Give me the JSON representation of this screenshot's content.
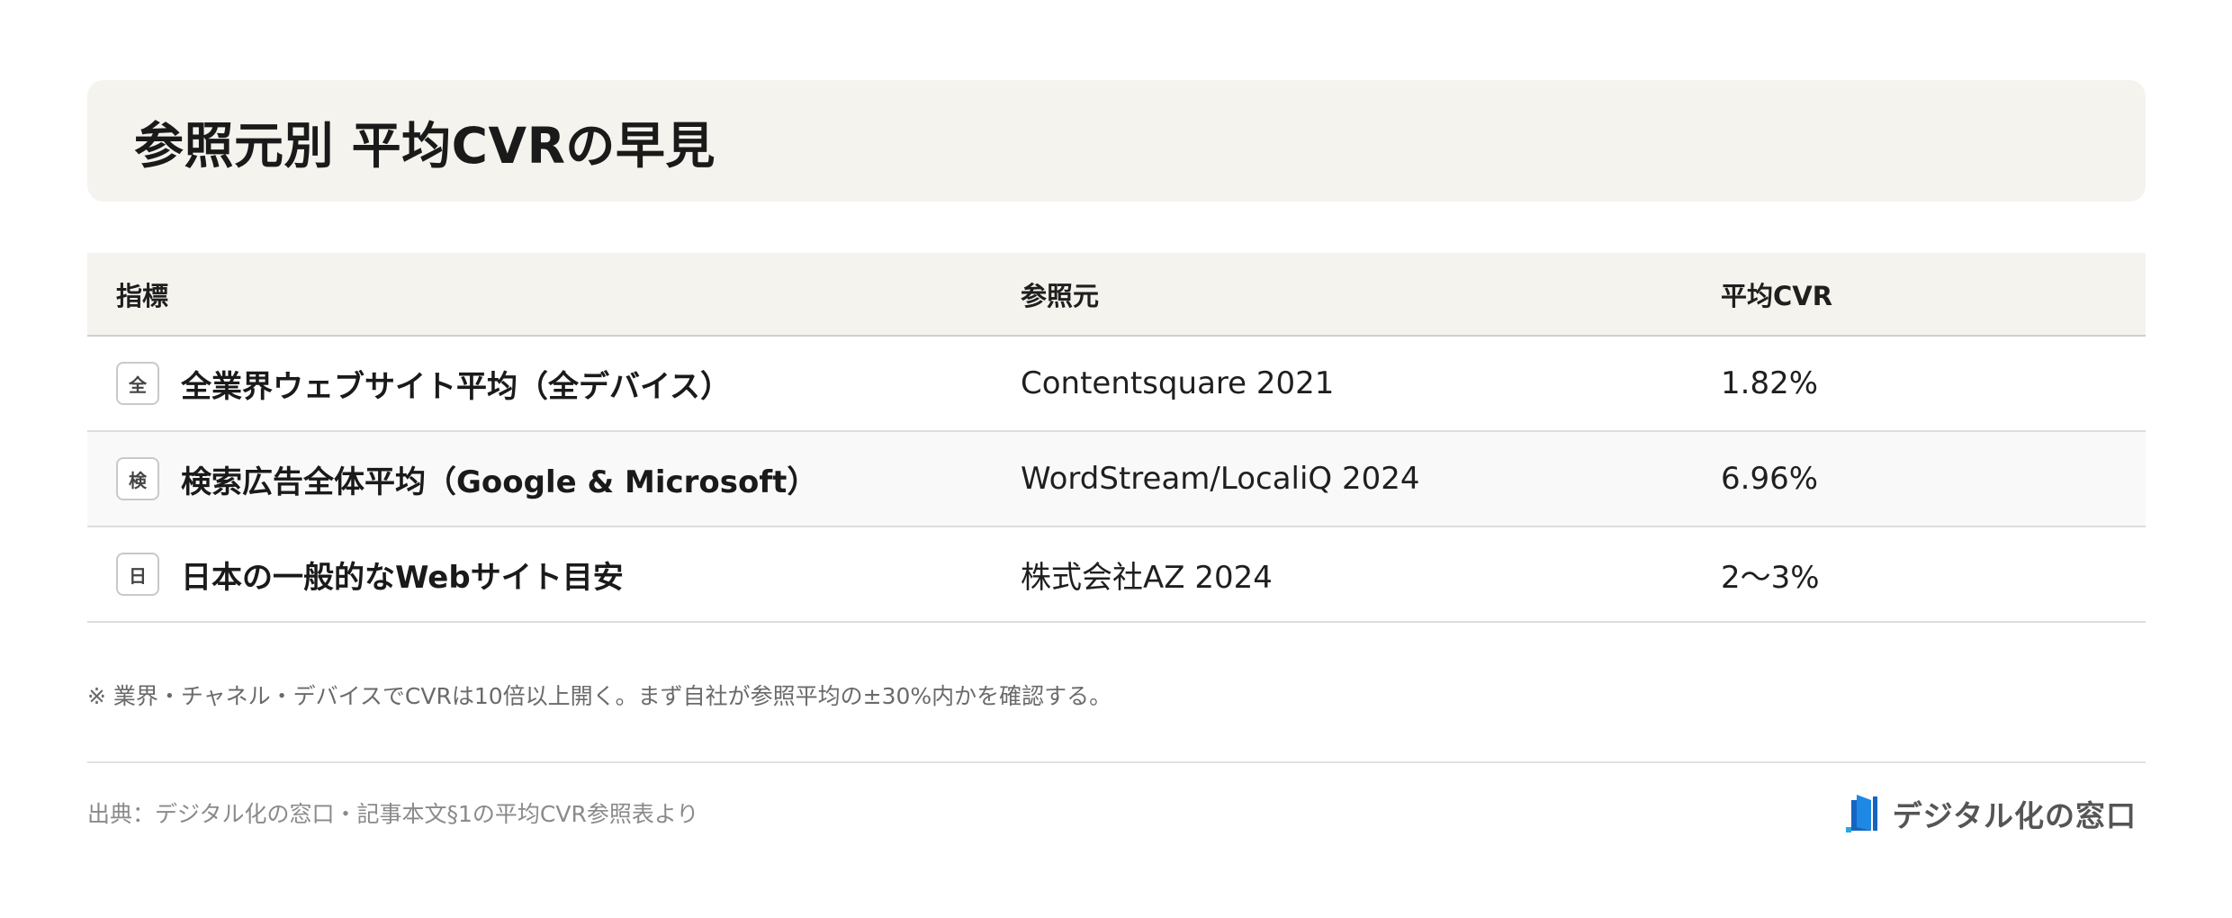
{
  "title": "参照元別 平均CVRの早見",
  "table": {
    "headers": {
      "metric": "指標",
      "source": "参照元",
      "cvr": "平均CVR"
    },
    "rows": [
      {
        "badge": "全",
        "metric": "全業界ウェブサイト平均（全デバイス）",
        "source": "Contentsquare 2021",
        "cvr": "1.82%"
      },
      {
        "badge": "検",
        "metric": "検索広告全体平均（Google & Microsoft）",
        "source": "WordStream/LocaliQ 2024",
        "cvr": "6.96%"
      },
      {
        "badge": "日",
        "metric": "日本の一般的なWebサイト目安",
        "source": "株式会社AZ 2024",
        "cvr": "2〜3%"
      }
    ]
  },
  "note": "※ 業界・チャネル・デバイスでCVRは10倍以上開く。まず自社が参照平均の±30%内かを確認する。",
  "footer": {
    "source": "出典：デジタル化の窓口・記事本文§1の平均CVR参照表より",
    "logo_text": "デジタル化の窓口",
    "logo_icon": "book-logo-icon"
  },
  "colors": {
    "panel_bg": "#f5f3ee",
    "logo_blue": "#1565c0",
    "logo_accent": "#29a8e0"
  }
}
